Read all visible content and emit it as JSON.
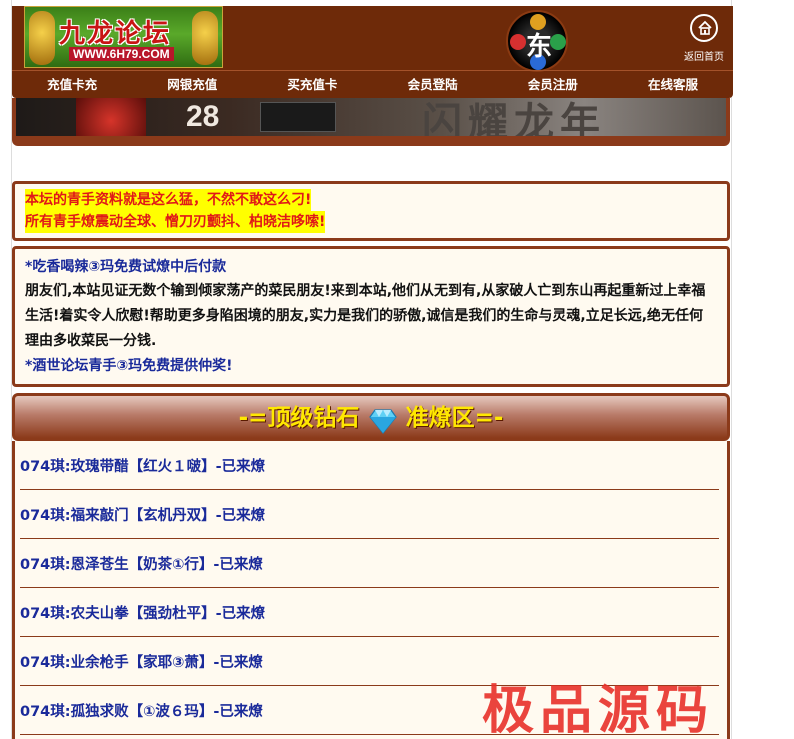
{
  "header": {
    "logo_title": "九龙论坛",
    "logo_url": "WWW.6H79.COM",
    "emblem_glyph": "东",
    "home_label": "返回首页"
  },
  "nav": {
    "items": [
      "充值卡充",
      "网银充值",
      "买充值卡",
      "会员登陆",
      "会员注册",
      "在线客服"
    ]
  },
  "banner": {
    "number": "28",
    "headline": "闪耀龙年"
  },
  "notice": {
    "line1": "本坛的青手资料就是这么猛，不然不敢这么刁!",
    "line2": "所有青手燎震动全球、憎刀刃颤抖、柏晓洁哆嗦!"
  },
  "intro": {
    "head": "*吃香喝辣③玛免费试燎中后付款",
    "body": "朋友们,本站见证无数个输到倾家荡产的菜民朋友!来到本站,他们从无到有,从家破人亡到东山再起重新过上幸福生活!着实令人欣慰!帮助更多身陷困境的朋友,实力是我们的骄傲,诚信是我们的生命与灵魂,立足长远,绝无任何理由多收菜民一分钱.",
    "foot": "*酒世论坛青手③玛免费提供仲奖!"
  },
  "zone": {
    "title_left": "-=顶级钻石",
    "title_right": "准燎区=-"
  },
  "list": {
    "rows": [
      "074琪:玫瑰带醋【红火１啵】-已来燎",
      "074琪:福来敲门【玄机丹双】-已来燎",
      "074琪:恩泽苍生【奶茶①行】-已来燎",
      "074琪:农夫山拳【强劲杜平】-已来燎",
      "074琪:业余枪手【家耶③萧】-已来燎",
      "074琪:孤独求败【①波６玛】-已来燎"
    ]
  },
  "watermark": "极品源码",
  "colors": {
    "brown": "#6e2a09",
    "border": "#8b3a1a",
    "link_blue": "#1a2a9a",
    "highlight_yellow": "#ffff00",
    "notice_red": "#e01818"
  }
}
